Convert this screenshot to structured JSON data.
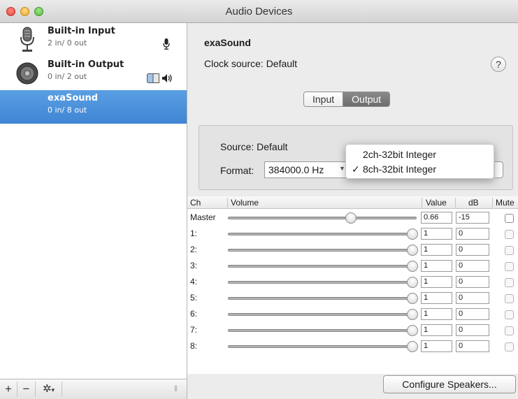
{
  "window": {
    "title": "Audio Devices"
  },
  "devices": [
    {
      "name": "Built-in Input",
      "io": "2 in/ 0 out",
      "icon": "microphone-icon",
      "selected": false
    },
    {
      "name": "Built-in Output",
      "io": "0 in/ 2 out",
      "icon": "speaker-icon",
      "selected": false
    },
    {
      "name": "exaSound",
      "io": "0 in/ 8 out",
      "icon": "none",
      "selected": true
    }
  ],
  "sidebar_toolbar": {
    "add": "+",
    "remove": "−",
    "gear_caret": "▾",
    "resize_grip": "|||"
  },
  "detail": {
    "device_name": "exaSound",
    "clock_source": "Clock source: Default",
    "help": "?",
    "tabs": [
      {
        "label": "Input",
        "active": false
      },
      {
        "label": "Output",
        "active": true
      }
    ],
    "source": "Source: Default",
    "format_label": "Format:",
    "format_value": "384000.0 Hz",
    "format_menu": [
      {
        "label": "2ch-32bit Integer",
        "checked": false
      },
      {
        "label": "8ch-32bit Integer",
        "checked": true
      }
    ],
    "check_glyph": "✓"
  },
  "table": {
    "headers": {
      "ch": "Ch",
      "volume": "Volume",
      "value": "Value",
      "db": "dB",
      "mute": "Mute"
    },
    "rows": [
      {
        "ch": "Master",
        "volume": 0.66,
        "value": "0.66",
        "db": "-15"
      },
      {
        "ch": "1:",
        "volume": 1,
        "value": "1",
        "db": "0"
      },
      {
        "ch": "2:",
        "volume": 1,
        "value": "1",
        "db": "0"
      },
      {
        "ch": "3:",
        "volume": 1,
        "value": "1",
        "db": "0"
      },
      {
        "ch": "4:",
        "volume": 1,
        "value": "1",
        "db": "0"
      },
      {
        "ch": "5:",
        "volume": 1,
        "value": "1",
        "db": "0"
      },
      {
        "ch": "6:",
        "volume": 1,
        "value": "1",
        "db": "0"
      },
      {
        "ch": "7:",
        "volume": 1,
        "value": "1",
        "db": "0"
      },
      {
        "ch": "8:",
        "volume": 1,
        "value": "1",
        "db": "0"
      }
    ]
  },
  "configure_button": "Configure Speakers...",
  "colors": {
    "selection": "#3f85d4",
    "window_bg": "#ececec"
  }
}
